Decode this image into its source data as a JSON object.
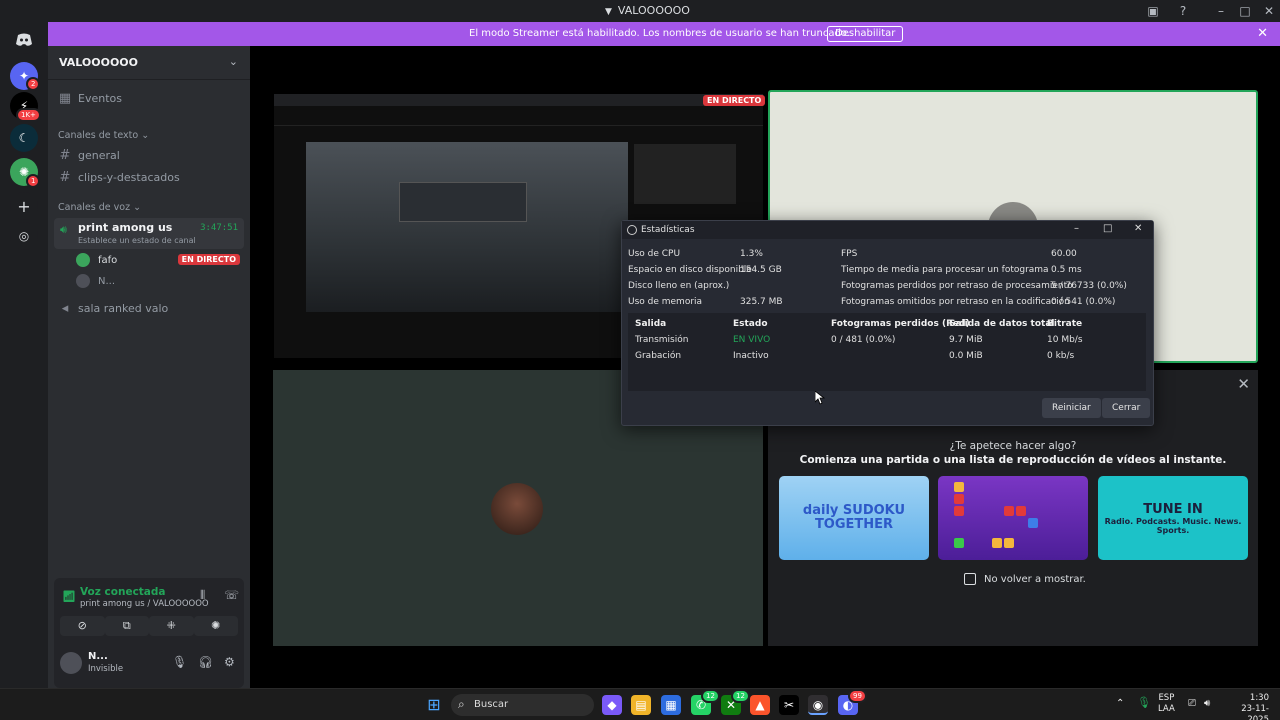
{
  "window": {
    "title": "VALOOOOOO"
  },
  "banner": {
    "text": "El modo Streamer está habilitado. Los nombres de usuario se han truncado.",
    "button": "Deshabilitar"
  },
  "rail": {
    "badges": [
      "2",
      "1K+",
      "",
      "1"
    ]
  },
  "sidebar": {
    "server_name": "VALOOOOOO",
    "events": "Eventos",
    "text_category": "Canales de texto",
    "text_channels": [
      "general",
      "clips-y-destacados"
    ],
    "voice_category": "Canales de voz",
    "active_voice": {
      "name": "print among us",
      "time": "3:47:51",
      "status": "Establece un estado de canal"
    },
    "voice_users": [
      {
        "name": "fafo",
        "live": "EN DIRECTO"
      },
      {
        "name": "N..."
      }
    ],
    "other_voice": "sala ranked valo"
  },
  "voice_connected": {
    "title": "Voz conectada",
    "subtitle": "print among us / VALOOOOOO"
  },
  "user": {
    "name": "N...",
    "status": "Invisible"
  },
  "stage": {
    "live_tag": "EN DIRECTO"
  },
  "activity": {
    "question": "¿Te apetece hacer algo?",
    "subtitle": "Comienza una partida o una lista de reproducción de vídeos al instante.",
    "cards": [
      {
        "title": "daily SUDOKU TOGETHER"
      },
      {
        "title": ""
      },
      {
        "title": "TUNE IN",
        "tagline": "Radio. Podcasts. Music. News. Sports."
      }
    ],
    "no_more": "No volver a mostrar."
  },
  "stats": {
    "title": "Estadísticas",
    "left": [
      {
        "label": "Uso de CPU",
        "value": "1.3%"
      },
      {
        "label": "Espacio en disco disponible",
        "value": "154.5 GB"
      },
      {
        "label": "Disco lleno en (aprox.)",
        "value": ""
      },
      {
        "label": "Uso de memoria",
        "value": "325.7 MB"
      }
    ],
    "right": [
      {
        "label": "FPS",
        "value": "60.00"
      },
      {
        "label": "Tiempo de media para procesar un fotograma",
        "value": "0.5 ms"
      },
      {
        "label": "Fotogramas perdidos por retraso de procesamiento",
        "value": "5 / 76733 (0.0%)"
      },
      {
        "label": "Fotogramas omitidos por retraso en la codificación",
        "value": "0 / 541 (0.0%)"
      }
    ],
    "table": {
      "headers": [
        "Salida",
        "Estado",
        "Fotogramas perdidos (Red)",
        "Salida de datos total",
        "Bitrate"
      ],
      "rows": [
        [
          "Transmisión",
          "EN VIVO",
          "0 / 481 (0.0%)",
          "9.7 MiB",
          "10 Mb/s"
        ],
        [
          "Grabación",
          "Inactivo",
          "",
          "0.0 MiB",
          "0 kb/s"
        ]
      ]
    },
    "buttons": {
      "reset": "Reiniciar",
      "close": "Cerrar"
    }
  },
  "taskbar": {
    "search": "Buscar",
    "lang": "ESP",
    "lang2": "LAA",
    "time": "1:30",
    "date": "23-11-2025",
    "badges": [
      "12",
      "12",
      "99"
    ]
  },
  "colors": {
    "banner": "#a357e8",
    "live": "#da373c",
    "connected": "#23a559",
    "live_status": "#23a559"
  }
}
